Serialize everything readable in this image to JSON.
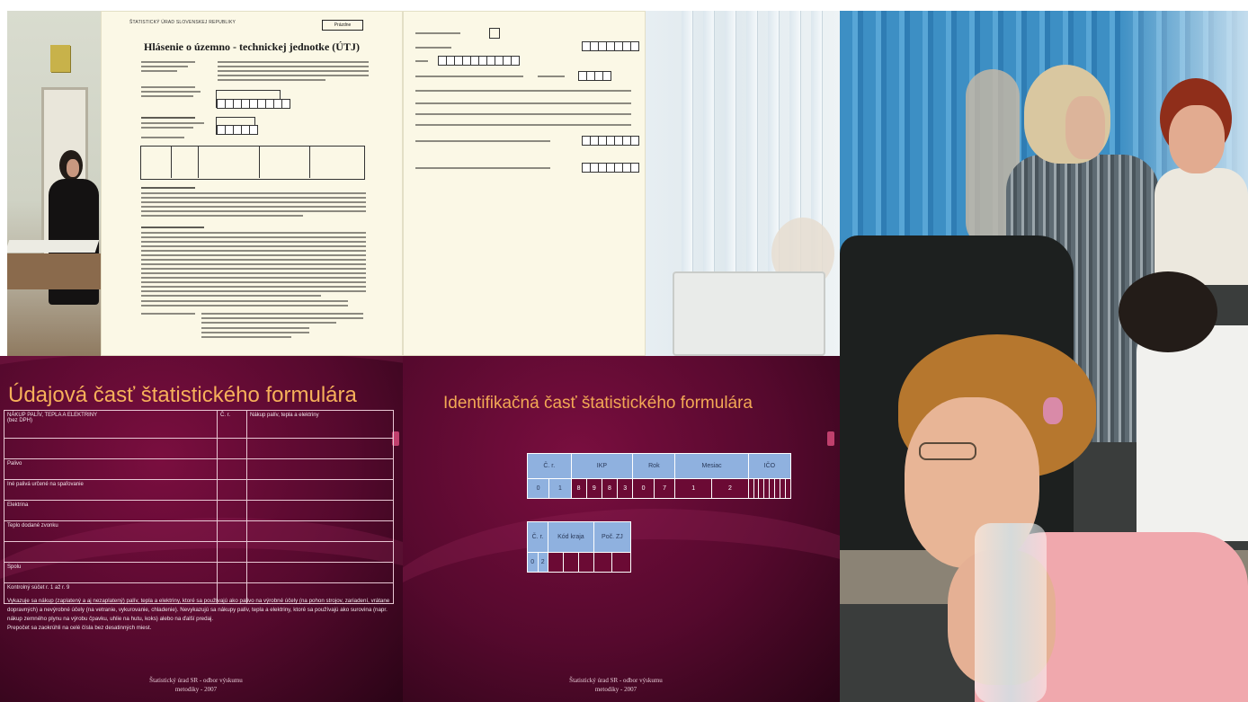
{
  "doc1": {
    "header_small": "ŠTATISTICKÝ ÚRAD SLOVENSKEJ REPUBLIKY",
    "button_box": "Prázdne",
    "title": "Hlásenie o územno - technickej jednotke (ÚTJ)"
  },
  "slide1": {
    "title": "Údajová časť štatistického formulára",
    "table_header": [
      "NÁKUP PALÍV, TEPLA A ELEKTRINY",
      "Č. r.",
      "Nákup palív, tepla a elektriny"
    ],
    "header_sub": "(bez DPH)",
    "rows": [
      "",
      "Palivo",
      "Iné palivá určené na spaľovanie",
      "Elektrina",
      "Teplo dodané zvonku",
      "",
      "Spolu",
      "Kontrolný súčet r. 1 až r. 9"
    ],
    "paragraph": "Vykazuje sa nákup (zaplatený a aj nezaplatený) palív, tepla a elektriny, ktoré sa používajú ako palivo na výrobné účely (na pohon strojov, zariadení, vrátane dopravných) a nevýrobné účely (na vetranie, vykurovanie, chladenie). Nevykazujú sa nákupy palív, tepla a elektriny, ktoré sa používajú ako surovina (napr. nákup zemného plynu na výrobu čpavku, uhlie na hutu, koks) alebo na ďalší predaj.",
    "paragraph_last": "Prepočet sa zaokrúhli na celé čísla bez desatinných miest.",
    "footer_line1": "Štatistický úrad SR - odbor výskumu",
    "footer_line2": "metodiky - 2007"
  },
  "slide2": {
    "title": "Identifikačná časť štatistického formulára",
    "table1_header": [
      "Č. r.",
      "IKP",
      "Rok",
      "Mesiac",
      "IČO"
    ],
    "table1_values": [
      "0",
      "1",
      "8",
      "9",
      "8",
      "3",
      "0",
      "7",
      "1",
      "2"
    ],
    "table2_header": [
      "Č. r.",
      "Kód kraja",
      "Poč. ZJ"
    ],
    "table2_values": [
      "0",
      "2"
    ],
    "footer_line1": "Štatistický úrad SR - odbor výskumu",
    "footer_line2": "metodiky - 2007"
  }
}
